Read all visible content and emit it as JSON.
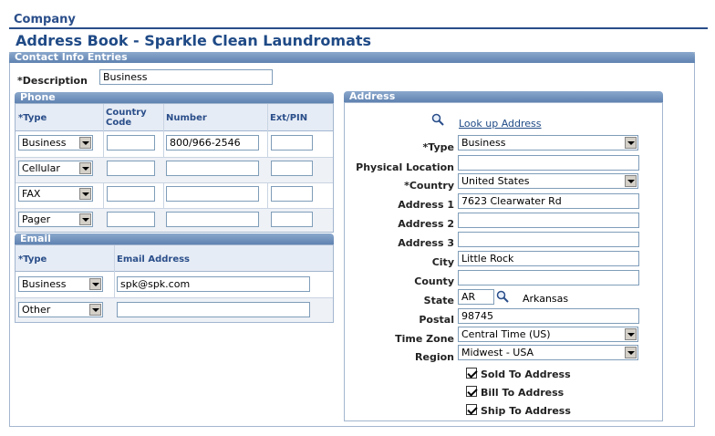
{
  "breadcrumb": "Company",
  "page_title": "Address Book - Sparkle Clean Laundromats",
  "contact_section": {
    "header": "Contact Info Entries",
    "description_label": "*Description",
    "description_value": "Business"
  },
  "phone": {
    "header": "Phone",
    "columns": {
      "type": "*Type",
      "country_code": "Country Code",
      "number": "Number",
      "ext": "Ext/PIN"
    },
    "rows": [
      {
        "type": "Business",
        "country_code": "",
        "number": "800/966-2546",
        "ext": ""
      },
      {
        "type": "Cellular",
        "country_code": "",
        "number": "",
        "ext": ""
      },
      {
        "type": "FAX",
        "country_code": "",
        "number": "",
        "ext": ""
      },
      {
        "type": "Pager",
        "country_code": "",
        "number": "",
        "ext": ""
      }
    ]
  },
  "email": {
    "header": "Email",
    "columns": {
      "type": "*Type",
      "address": "Email Address"
    },
    "rows": [
      {
        "type": "Business",
        "address": "spk@spk.com"
      },
      {
        "type": "Other",
        "address": ""
      }
    ]
  },
  "address": {
    "header": "Address",
    "lookup_link": "Look up Address",
    "labels": {
      "type": "*Type",
      "physical_location": "Physical Location",
      "country": "*Country",
      "address1": "Address 1",
      "address2": "Address 2",
      "address3": "Address 3",
      "city": "City",
      "county": "County",
      "state": "State",
      "postal": "Postal",
      "time_zone": "Time Zone",
      "region": "Region"
    },
    "values": {
      "type": "Business",
      "physical_location": "",
      "country": "United States",
      "address1": "7623 Clearwater Rd",
      "address2": "",
      "address3": "",
      "city": "Little Rock",
      "county": "",
      "state": "AR",
      "state_name": "Arkansas",
      "postal": "98745",
      "time_zone": "Central Time (US)",
      "region": "Midwest - USA"
    },
    "checkboxes": [
      {
        "label": "Sold To Address",
        "checked": true
      },
      {
        "label": "Bill To Address",
        "checked": true
      },
      {
        "label": "Ship To Address",
        "checked": true
      }
    ]
  },
  "colors": {
    "header_blue": "#2a4e8a",
    "group_header": "#6f90bd",
    "border": "#a3b6cf"
  },
  "icons": [
    "magnifier-icon",
    "dropdown-arrow-icon",
    "checkmark-icon"
  ]
}
